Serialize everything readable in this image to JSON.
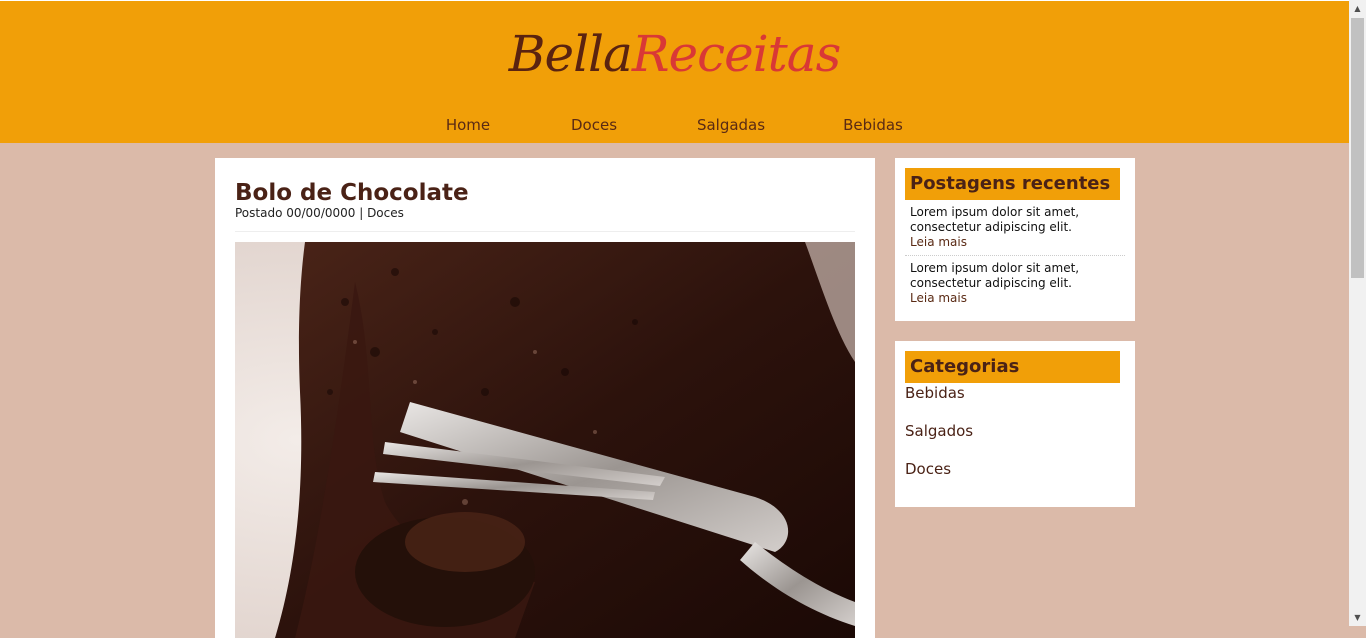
{
  "site": {
    "logo_part1": "Bella",
    "logo_part2": "Receitas",
    "colors": {
      "header": "#f19f08",
      "background": "#dbbaa9",
      "brand_dark": "#5a2310",
      "brand_red": "#d93836"
    }
  },
  "nav": {
    "items": [
      {
        "label": "Home"
      },
      {
        "label": "Doces"
      },
      {
        "label": "Salgadas"
      },
      {
        "label": "Bebidas"
      }
    ]
  },
  "post": {
    "title": "Bolo de Chocolate",
    "meta": "Postado 00/00/0000 | Doces",
    "image_icon": "chocolate-cake-photo"
  },
  "recent": {
    "title": "Postagens recentes",
    "items": [
      {
        "text": "Lorem ipsum dolor sit amet, consectetur adipiscing elit.",
        "more": "Leia mais"
      },
      {
        "text": "Lorem ipsum dolor sit amet, consectetur adipiscing elit.",
        "more": "Leia mais"
      }
    ]
  },
  "categories": {
    "title": "Categorias",
    "items": [
      {
        "label": "Bebidas"
      },
      {
        "label": "Salgados"
      },
      {
        "label": "Doces"
      }
    ]
  }
}
